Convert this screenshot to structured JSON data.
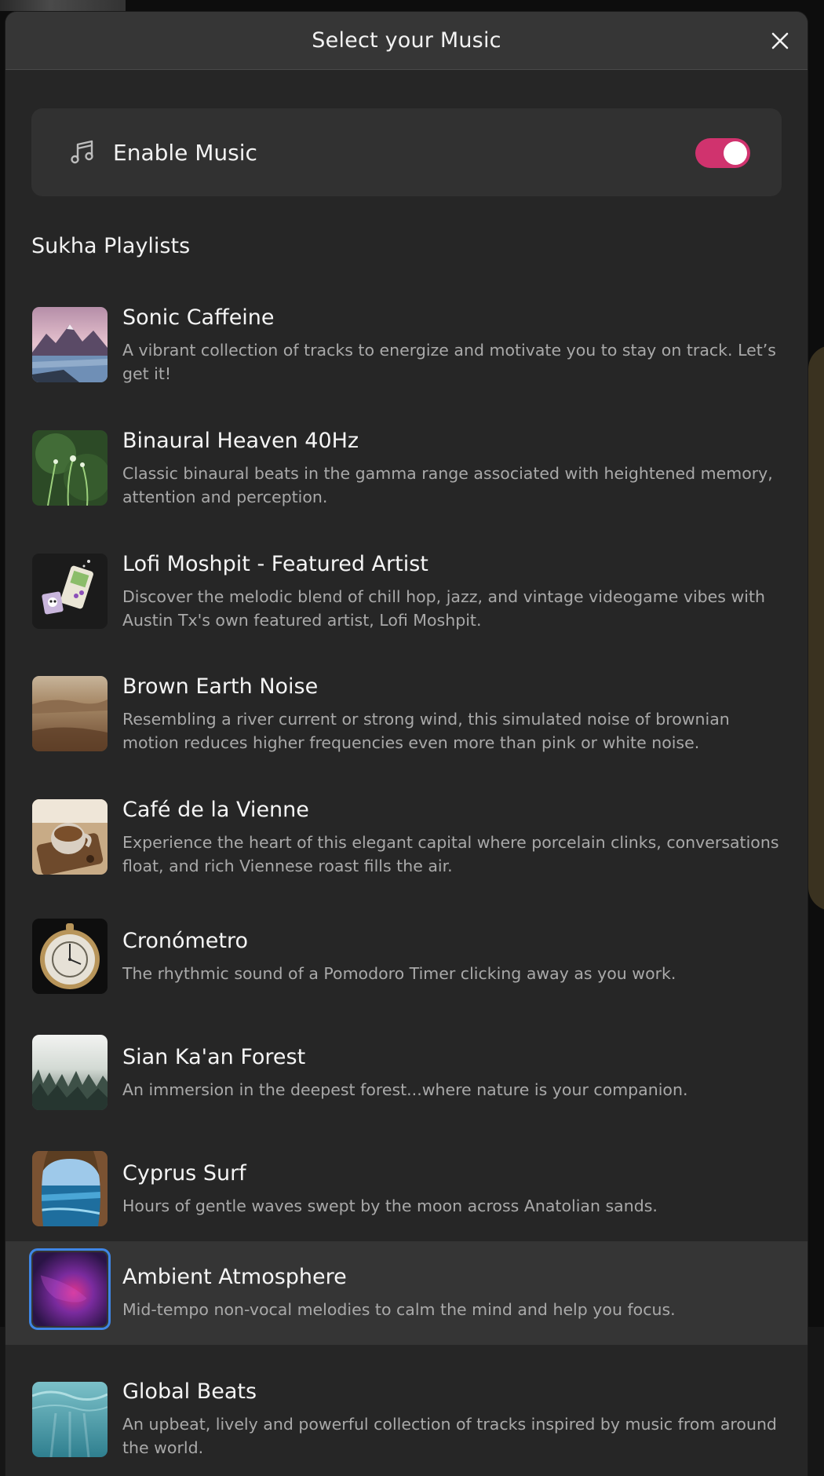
{
  "modal": {
    "title": "Select your Music",
    "close_icon": "close-icon"
  },
  "enable": {
    "label": "Enable Music",
    "icon": "music-note-icon",
    "enabled": true,
    "toggle_color": "#d0336e"
  },
  "section": {
    "title": "Sukha Playlists"
  },
  "playlists": [
    {
      "title": "Sonic Caffeine",
      "desc": "A vibrant collection of tracks to energize and motivate you to stay on track. Let’s get it!",
      "thumb": "mountain-lake"
    },
    {
      "title": "Binaural Heaven 40Hz",
      "desc": "Classic binaural beats in the gamma range associated with heightened memory, attention and perception.",
      "thumb": "green-grass"
    },
    {
      "title": "Lofi Moshpit - Featured Artist",
      "desc": "Discover the melodic blend of chill hop, jazz, and vintage videogame vibes with Austin Tx's own featured artist, Lofi Moshpit.",
      "thumb": "handheld-console"
    },
    {
      "title": "Brown Earth Noise",
      "desc": "Resembling a river current or strong wind, this simulated noise of brownian motion reduces higher frequencies even more than pink or white noise.",
      "thumb": "desert"
    },
    {
      "title": "Café de la Vienne",
      "desc": "Experience the heart of this elegant capital where porcelain clinks, conversations float, and rich Viennese roast fills the air.",
      "thumb": "coffee-cup"
    },
    {
      "title": "Cronómetro",
      "desc": "The rhythmic sound of a Pomodoro Timer clicking away as you work.",
      "thumb": "pocket-watch"
    },
    {
      "title": "Sian Ka'an Forest",
      "desc": "An immersion in the deepest forest...where nature is your companion.",
      "thumb": "misty-forest"
    },
    {
      "title": "Cyprus Surf",
      "desc": "Hours of gentle waves swept by the moon across Anatolian sands.",
      "thumb": "sea-cave"
    },
    {
      "title": "Ambient Atmosphere",
      "desc": "Mid-tempo non-vocal melodies to calm the mind and help you focus.",
      "thumb": "purple-gradient",
      "selected": true
    },
    {
      "title": "Global Beats",
      "desc": "An upbeat, lively and powerful collection of tracks inspired by music from around the world.",
      "thumb": "underwater"
    }
  ]
}
